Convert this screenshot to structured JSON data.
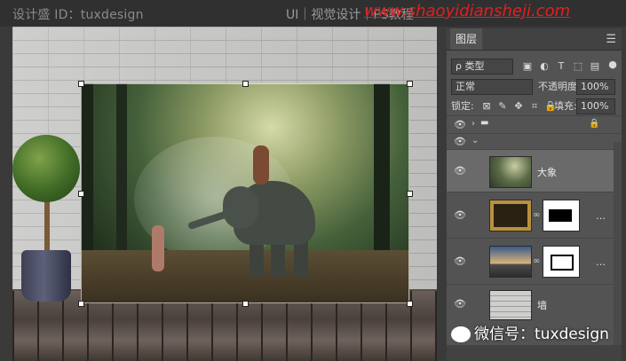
{
  "header": {
    "credit_text": "设计盛 ID：tuxdesign",
    "course_text": "UI｜视觉设计｜PS教程",
    "watermark_url": "www.shaoyidiansheji.com"
  },
  "canvas": {
    "photo_layer_name": "大象"
  },
  "layers_panel": {
    "tab_label": "图层",
    "filter_label": "ρ 类型",
    "blend_mode": "正常",
    "opacity_label": "不透明度:",
    "opacity_value": "100%",
    "lock_label": "锁定:",
    "fill_label": "填充:",
    "fill_value": "100%",
    "layers": [
      {
        "name": "",
        "kind": "group-collapsed"
      },
      {
        "name": "",
        "kind": "group-open"
      },
      {
        "name": "大象",
        "kind": "smart-object"
      },
      {
        "name": "",
        "kind": "frame-with-mask"
      },
      {
        "name": "",
        "kind": "road-with-mask"
      },
      {
        "name": "墙",
        "kind": "smart-object"
      }
    ]
  },
  "footer_watermark": "微信号：tuxdesign",
  "colors": {
    "watermark_red": "#e02020",
    "panel_bg": "#535353",
    "selected_layer": "#6a6a6a"
  }
}
